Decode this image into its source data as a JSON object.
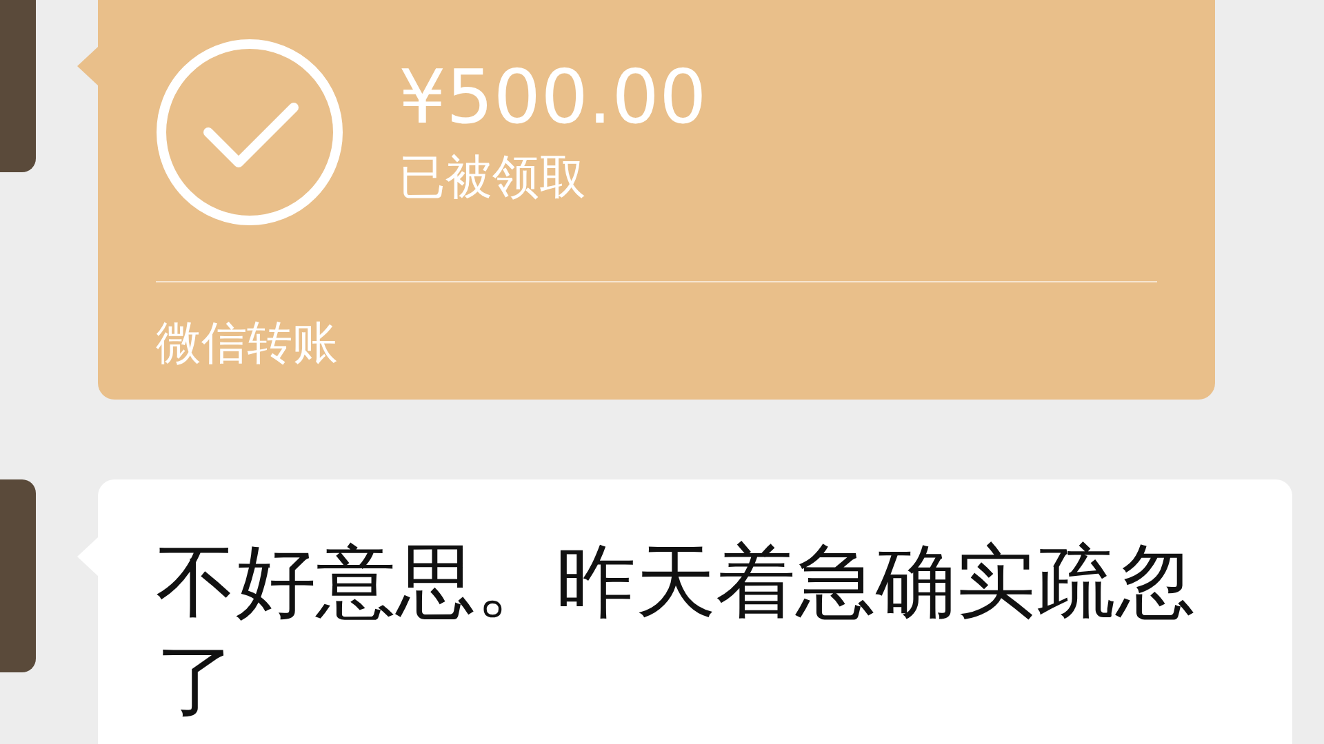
{
  "messages": [
    {
      "kind": "transfer",
      "amount": "¥500.00",
      "status": "已被领取",
      "received": true,
      "label": "微信转账"
    },
    {
      "kind": "text",
      "text": "不好意思。昨天着急确实疏忽了"
    }
  ]
}
